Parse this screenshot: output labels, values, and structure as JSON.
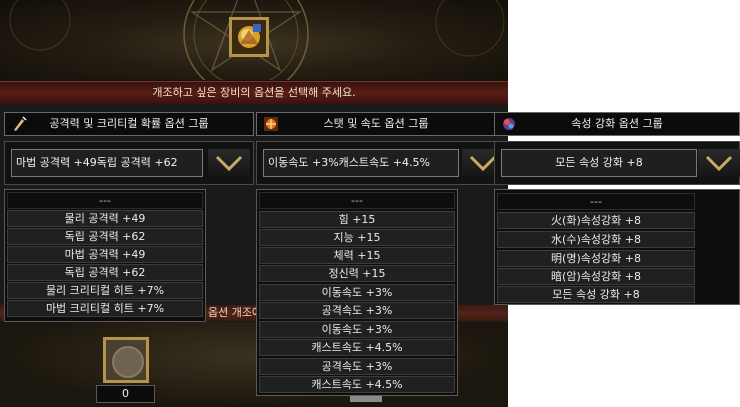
{
  "instruction": "개조하고 싶은 장비의 옵션을 선택해 주세요.",
  "partial_label": "옵션 개조에",
  "count_value": "0",
  "colors": {
    "accent_gold": "#b8934a",
    "banner_red": "#5a1c16",
    "panel_black": "#0b0b0b"
  },
  "panels": [
    {
      "title": "공격력 및 크리티컬 확률 옵션 그룹",
      "icon": "attack-crit-icon",
      "selected": "마법 공격력 +49독립 공격력 +62",
      "options": [
        "---",
        "물리 공격력 +49",
        "독립 공격력 +62",
        "마법 공격력 +49",
        "독립 공격력 +62",
        "물리 크리티컬 히트 +7%",
        "마법 크리티컬 히트 +7%"
      ]
    },
    {
      "title": "스탯 및 속도 옵션 그룹",
      "icon": "stat-speed-icon",
      "selected": "이동속도 +3%캐스트속도 +4.5%",
      "options": [
        "---",
        "힘 +15",
        "지능 +15",
        "체력 +15",
        "정신력 +15",
        "이동속도 +3%",
        "공격속도 +3%",
        "이동속도 +3%",
        "캐스트속도 +4.5%",
        "공격속도 +3%",
        "캐스트속도 +4.5%"
      ]
    },
    {
      "title": "속성 강화 옵션 그룹",
      "icon": "element-enhance-icon",
      "selected": "모든 속성 강화 +8",
      "options": [
        "---",
        "火(화)속성강화 +8",
        "水(수)속성강화 +8",
        "明(명)속성강화 +8",
        "暗(암)속성강화 +8",
        "모든 속성 강화 +8"
      ]
    }
  ]
}
